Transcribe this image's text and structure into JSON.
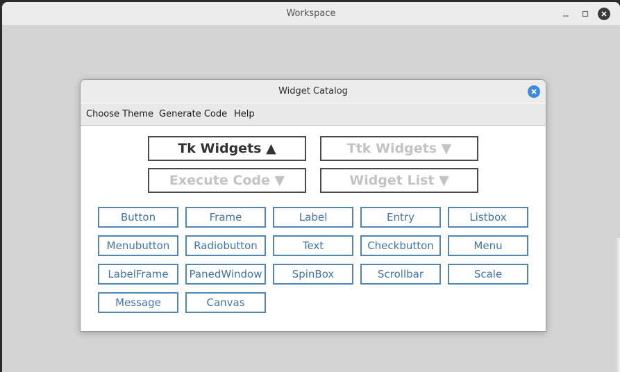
{
  "outer_window": {
    "title": "Workspace"
  },
  "dialog": {
    "title": "Widget Catalog",
    "menu": [
      "Choose Theme",
      "Generate Code",
      "Help"
    ],
    "big_buttons": [
      {
        "label": "Tk Widgets ▲",
        "state": "active"
      },
      {
        "label": "Ttk Widgets ▼",
        "state": "disabled"
      },
      {
        "label": "Execute Code ▼",
        "state": "disabled"
      },
      {
        "label": "Widget List ▼",
        "state": "disabled"
      }
    ],
    "widgets": [
      "Button",
      "Frame",
      "Label",
      "Entry",
      "Listbox",
      "Menubutton",
      "Radiobutton",
      "Text",
      "Checkbutton",
      "Menu",
      "LabelFrame",
      "PanedWindow",
      "SpinBox",
      "Scrollbar",
      "Scale",
      "Message",
      "Canvas"
    ]
  },
  "colors": {
    "accent_close": "#3d8ad6",
    "widget_border": "#4f86b8",
    "widget_text": "#3f74a8"
  }
}
